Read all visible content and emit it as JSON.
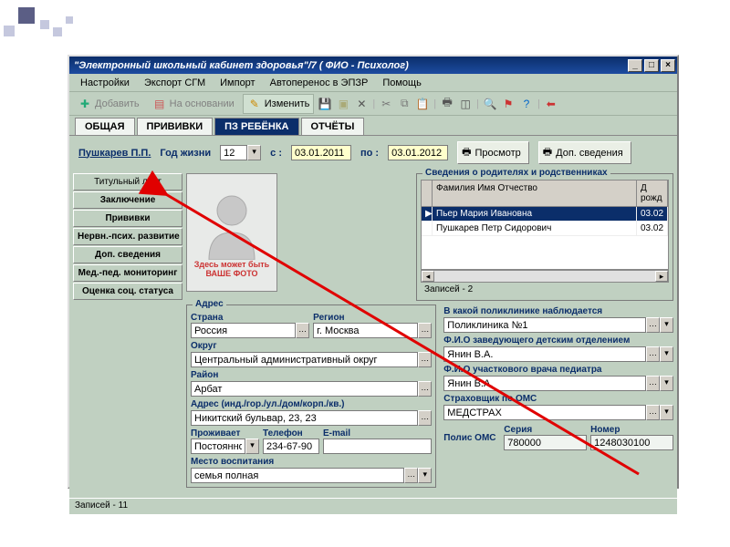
{
  "titlebar": {
    "title": "\"Электронный школьный кабинет здоровья\"/7 ( ФИО - Психолог)"
  },
  "menu": {
    "settings": "Настройки",
    "exportSGM": "Экспорт СГМ",
    "import": "Импорт",
    "autotransfer": "Автоперенос в ЭПЗР",
    "help": "Помощь"
  },
  "toolbar": {
    "add": "Добавить",
    "basedOn": "На основании",
    "edit": "Изменить"
  },
  "tabs": {
    "general": "ОБЩАЯ",
    "vaccinations": "ПРИВИВКИ",
    "childPZ": "ПЗ РЕБЁНКА",
    "reports": "ОТЧЁТЫ"
  },
  "subbar": {
    "patient": "Пушкарев П.П.",
    "yearLabel": "Год жизни",
    "yearValue": "12",
    "fromLabel": "с :",
    "fromDate": "03.01.2011",
    "toLabel": "по :",
    "toDate": "03.01.2012",
    "viewBtn": "Просмотр",
    "extraBtn": "Доп. сведения"
  },
  "sidebar": [
    "Титульный лист",
    "Заключение",
    "Прививки",
    "Нервн.-псих. развитие",
    "Доп. сведения",
    "Мед.-пед. мониторинг",
    "Оценка соц. статуса"
  ],
  "photo": {
    "line1": "Здесь может быть",
    "line2": "ВАШЕ ФОТО"
  },
  "relatives": {
    "legend": "Сведения о родителях и родственниках",
    "colName": "Фамилия Имя Отчество",
    "colDob": "Д рожд",
    "rows": [
      {
        "name": "Пьер Мария Ивановна",
        "dob": "03.02"
      },
      {
        "name": "Пушкарев Петр Сидорович",
        "dob": "03.02"
      }
    ],
    "count": "Записей - 2"
  },
  "address": {
    "legend": "Адрес",
    "countryLabel": "Страна",
    "country": "Россия",
    "regionLabel": "Регион",
    "region": "г. Москва",
    "okrugLabel": "Округ",
    "okrug": "Центральный административный округ",
    "districtLabel": "Район",
    "district": "Арбат",
    "addrLabel": "Адрес (инд./гор./ул./дом/корп./кв.)",
    "addr": "Никитский бульвар, 23, 23",
    "residesLabel": "Проживает",
    "resides": "Постоянно",
    "phoneLabel": "Телефон",
    "phone": "234-67-90",
    "emailLabel": "E-mail",
    "email": "",
    "upbringingLabel": "Место воспитания",
    "upbringing": "семья полная"
  },
  "medical": {
    "clinicLabel": "В какой поликлинике наблюдается",
    "clinic": "Поликлиника №1",
    "headLabel": "Ф.И.О заведующего детским отделением",
    "head": "Янин В.А.",
    "doctorLabel": "Ф.И.О участкового врача педиатра",
    "doctor": "Янин В.А.",
    "insurerLabel": "Страховщик по ОМС",
    "insurer": "МЕДСТРАХ",
    "policyLabel": "Полис ОМС",
    "seriesLabel": "Серия",
    "series": "780000",
    "numberLabel": "Номер",
    "number": "1248030100"
  },
  "statusbar": "Записей - 11"
}
